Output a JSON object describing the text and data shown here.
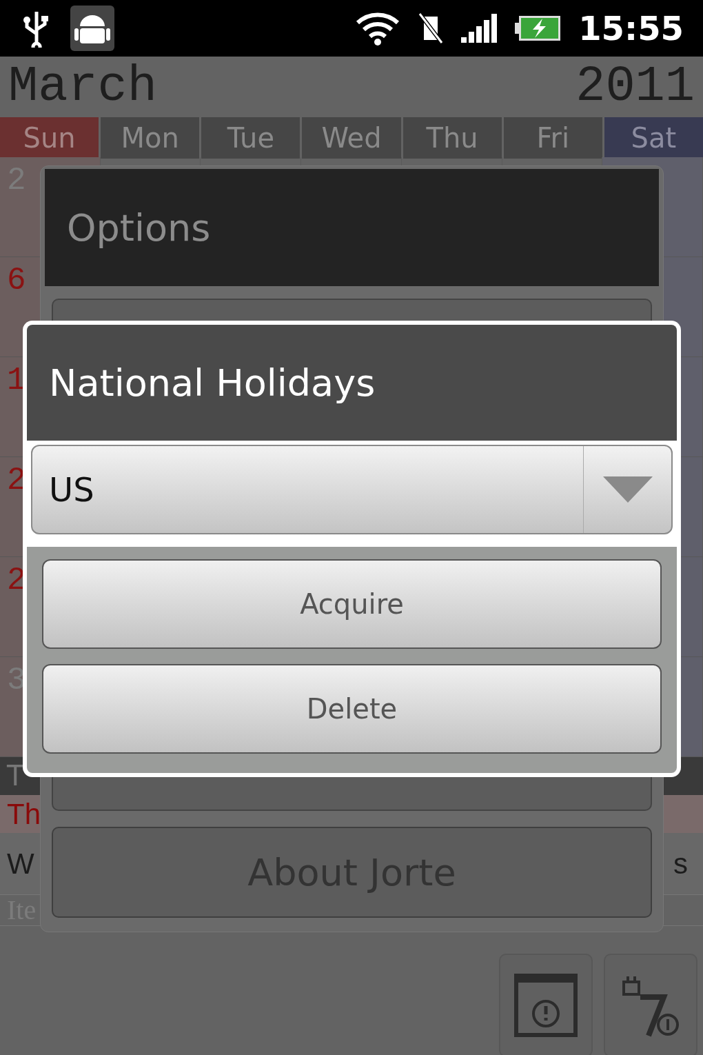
{
  "status_bar": {
    "time": "15:55"
  },
  "calendar": {
    "month": "March",
    "year": "2011",
    "weekdays": [
      {
        "label": "Sun",
        "kind": "sunday"
      },
      {
        "label": "Mon",
        "kind": "weekday"
      },
      {
        "label": "Tue",
        "kind": "weekday"
      },
      {
        "label": "Wed",
        "kind": "weekday"
      },
      {
        "label": "Thu",
        "kind": "weekday"
      },
      {
        "label": "Fri",
        "kind": "weekday"
      },
      {
        "label": "Sat",
        "kind": "saturday"
      }
    ],
    "sunday_dates": [
      {
        "text": "2",
        "other_month": true
      },
      {
        "text": "6",
        "other_month": false
      },
      {
        "text": "1",
        "other_month": false
      },
      {
        "text": "2",
        "other_month": false
      },
      {
        "text": "2",
        "other_month": false
      },
      {
        "text": "3",
        "other_month": true
      }
    ]
  },
  "agenda": {
    "header": "T",
    "rows": [
      {
        "text": "Th",
        "kind": "holiday"
      },
      {
        "text": "W",
        "kind": "event",
        "right_text": "s"
      },
      {
        "text": "Ite",
        "kind": "hint"
      }
    ]
  },
  "options_dialog": {
    "title": "Options",
    "buttons": [
      {
        "label": "About Jorte"
      }
    ]
  },
  "holiday_dialog": {
    "title": "National Holidays",
    "country": "US",
    "buttons": [
      "Acquire",
      "Delete"
    ]
  }
}
